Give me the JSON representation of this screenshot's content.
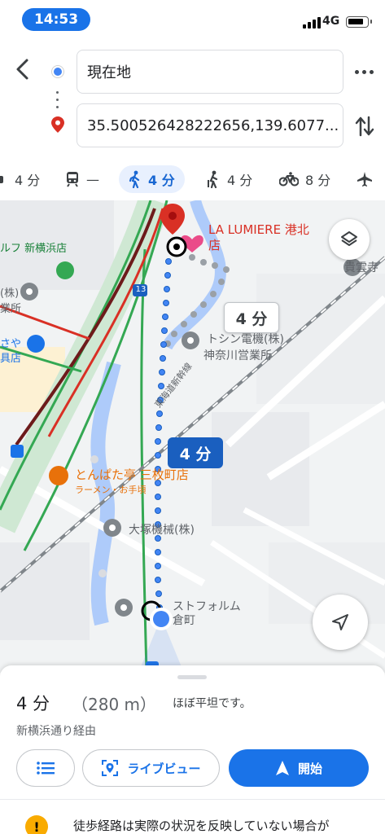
{
  "status_bar": {
    "time": "14:53",
    "network": "4G"
  },
  "route": {
    "origin": "現在地",
    "destination": "35.500526428222656,139.6077..."
  },
  "modes": [
    {
      "icon": "car-icon",
      "label": "4 分"
    },
    {
      "icon": "train-icon",
      "label": "—"
    },
    {
      "icon": "walk-icon",
      "label": "4 分",
      "active": true
    },
    {
      "icon": "ride-icon",
      "label": "4 分"
    },
    {
      "icon": "bike-icon",
      "label": "8 分"
    },
    {
      "icon": "flight-icon",
      "label": ""
    }
  ],
  "map": {
    "labels": {
      "golf": "ルフ 新横浜店",
      "kabu": "(株)",
      "shoten": "業所",
      "saya": "さや",
      "saya2": "具店",
      "la_lumiere": "LA LUMIERE 港北",
      "la_lumiere2": "店",
      "kiunji": "貴雲寺",
      "toshin": "トシン電機(株)",
      "toshin2": "神奈川営業所",
      "tokaido": "東海道新幹線",
      "tonpata": "とんぱた亭 三枚町店",
      "tonpata2": "ラーメン・お手頃",
      "otsuka": "大塚機械(株)",
      "form": "ストフォルム",
      "form2": "倉町",
      "road_num": "13"
    },
    "time_bubble_white": "4 分",
    "time_bubble_blue": "4 分"
  },
  "sheet": {
    "duration": "4 分",
    "distance": "（280 m）",
    "note": "ほぼ平坦です。",
    "via": "新横浜通り経由",
    "live_view": "ライブビュー",
    "start": "開始",
    "warning": "徒歩経路は実際の状況を反映していない場合が"
  },
  "colors": {
    "accent": "#1a73e8",
    "route_blue": "#4285f4",
    "river": "#aecbfa",
    "rail_green": "#34a853",
    "pin_red": "#d93025"
  }
}
